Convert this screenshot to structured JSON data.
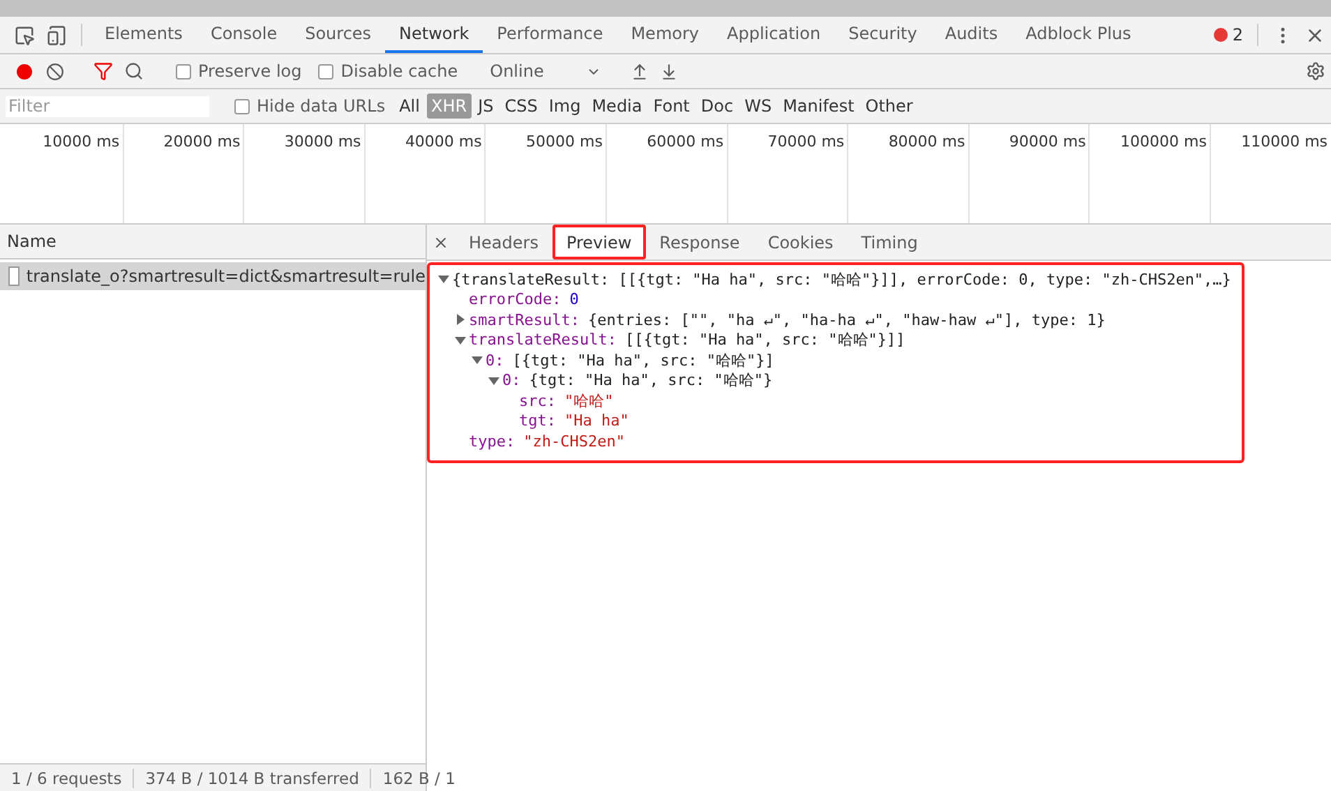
{
  "panel_tabs": [
    {
      "label": "Elements",
      "selected": false
    },
    {
      "label": "Console",
      "selected": false
    },
    {
      "label": "Sources",
      "selected": false
    },
    {
      "label": "Network",
      "selected": true
    },
    {
      "label": "Performance",
      "selected": false
    },
    {
      "label": "Memory",
      "selected": false
    },
    {
      "label": "Application",
      "selected": false
    },
    {
      "label": "Security",
      "selected": false
    },
    {
      "label": "Audits",
      "selected": false
    },
    {
      "label": "Adblock Plus",
      "selected": false
    }
  ],
  "error_count": "2",
  "toolbar": {
    "recording": true,
    "preserve_log": {
      "label": "Preserve log",
      "checked": false
    },
    "disable_cache": {
      "label": "Disable cache",
      "checked": false
    },
    "throttling": "Online"
  },
  "filter_bar": {
    "placeholder": "Filter",
    "hide_data_urls": {
      "label": "Hide data URLs",
      "checked": false
    },
    "types": [
      {
        "label": "All",
        "selected": false
      },
      {
        "label": "XHR",
        "selected": true
      },
      {
        "label": "JS",
        "selected": false
      },
      {
        "label": "CSS",
        "selected": false
      },
      {
        "label": "Img",
        "selected": false
      },
      {
        "label": "Media",
        "selected": false
      },
      {
        "label": "Font",
        "selected": false
      },
      {
        "label": "Doc",
        "selected": false
      },
      {
        "label": "WS",
        "selected": false
      },
      {
        "label": "Manifest",
        "selected": false
      },
      {
        "label": "Other",
        "selected": false
      }
    ]
  },
  "timeline_ticks": [
    "10000 ms",
    "20000 ms",
    "30000 ms",
    "40000 ms",
    "50000 ms",
    "60000 ms",
    "70000 ms",
    "80000 ms",
    "90000 ms",
    "100000 ms",
    "110000 ms"
  ],
  "requests": {
    "column": "Name",
    "rows": [
      {
        "name": "translate_o?smartresult=dict&smartresult=rule",
        "selected": true
      }
    ]
  },
  "status_bar": [
    "1 / 6 requests",
    "374 B / 1014 B transferred",
    "162 B / 1"
  ],
  "detail_tabs": [
    {
      "label": "Headers",
      "selected": false,
      "highlighted": false
    },
    {
      "label": "Preview",
      "selected": true,
      "highlighted": true
    },
    {
      "label": "Response",
      "selected": false,
      "highlighted": false
    },
    {
      "label": "Cookies",
      "selected": false,
      "highlighted": false
    },
    {
      "label": "Timing",
      "selected": false,
      "highlighted": false
    }
  ],
  "preview": {
    "highlighted": true,
    "tree": [
      {
        "value": "{translateResult: [[{tgt: \"Ha ha\", src: \"哈哈\"}]], errorCode: 0, type: \"zh-CHS2en\",…}",
        "kind": "object",
        "expanded": true,
        "children": [
          {
            "key": "errorCode:",
            "value": "0",
            "kind": "number"
          },
          {
            "key": "smartResult:",
            "value": "{entries: [\"\", \"ha ↵\", \"ha-ha ↵\", \"haw-haw ↵\"], type: 1}",
            "kind": "object",
            "expanded": false
          },
          {
            "key": "translateResult:",
            "value": "[[{tgt: \"Ha ha\", src: \"哈哈\"}]]",
            "kind": "object",
            "expanded": true,
            "children": [
              {
                "key": "0:",
                "value": "[{tgt: \"Ha ha\", src: \"哈哈\"}]",
                "kind": "object",
                "expanded": true,
                "children": [
                  {
                    "key": "0:",
                    "value": "{tgt: \"Ha ha\", src: \"哈哈\"}",
                    "kind": "object",
                    "expanded": true,
                    "children": [
                      {
                        "key": "src:",
                        "value": "\"哈哈\"",
                        "kind": "string"
                      },
                      {
                        "key": "tgt:",
                        "value": "\"Ha ha\"",
                        "kind": "string"
                      }
                    ]
                  }
                ]
              }
            ]
          },
          {
            "key": "type:",
            "value": "\"zh-CHS2en\"",
            "kind": "string"
          }
        ]
      }
    ]
  }
}
